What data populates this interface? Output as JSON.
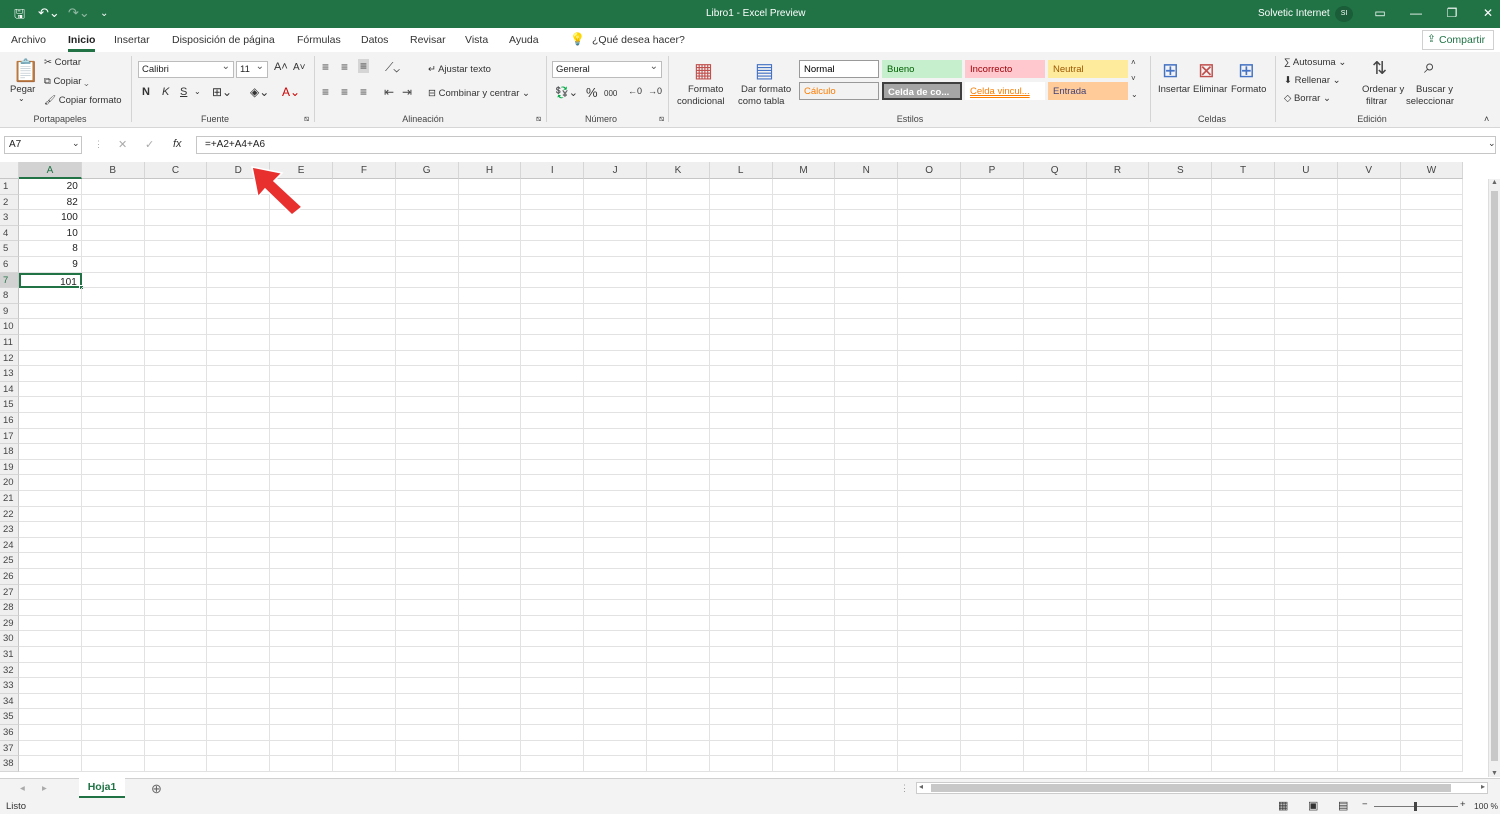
{
  "window": {
    "title": "Libro1 - Excel Preview",
    "user": "Solvetic Internet",
    "user_initials": "SI"
  },
  "tabs": [
    "Archivo",
    "Inicio",
    "Insertar",
    "Disposición de página",
    "Fórmulas",
    "Datos",
    "Revisar",
    "Vista",
    "Ayuda"
  ],
  "search_hint": "¿Qué desea hacer?",
  "share_label": "Compartir",
  "clipboard": {
    "paste": "Pegar",
    "cut": "Cortar",
    "copy": "Copiar",
    "format_painter": "Copiar formato",
    "group": "Portapapeles"
  },
  "font": {
    "name": "Calibri",
    "size": "11",
    "bold": "N",
    "italic": "K",
    "underline": "S",
    "group": "Fuente"
  },
  "alignment": {
    "wrap": "Ajustar texto",
    "merge": "Combinar y centrar",
    "group": "Alineación"
  },
  "number": {
    "format": "General",
    "percent": "%",
    "thousands": "000",
    "group": "Número"
  },
  "styles": {
    "cond_format": "Formato",
    "cond_format2": "condicional",
    "as_table": "Dar formato",
    "as_table2": "como tabla",
    "group": "Estilos",
    "items": [
      {
        "label": "Normal",
        "bg": "#ffffff",
        "fg": "#000000"
      },
      {
        "label": "Bueno",
        "bg": "#c6efce",
        "fg": "#006100"
      },
      {
        "label": "Incorrecto",
        "bg": "#ffc7ce",
        "fg": "#9c0006"
      },
      {
        "label": "Neutral",
        "bg": "#ffeb9c",
        "fg": "#9c5700"
      },
      {
        "label": "Cálculo",
        "bg": "#f2f2f2",
        "fg": "#fa7d00"
      },
      {
        "label": "Celda de co...",
        "bg": "#a5a5a5",
        "fg": "#ffffff"
      },
      {
        "label": "Celda vincul...",
        "bg": "#ffffff",
        "fg": "#fa7d00"
      },
      {
        "label": "Entrada",
        "bg": "#ffcc99",
        "fg": "#3f3f76"
      }
    ]
  },
  "cells_group": {
    "insert": "Insertar",
    "delete": "Eliminar",
    "format": "Formato",
    "group": "Celdas"
  },
  "editing": {
    "autosum": "Autosuma",
    "fill": "Rellenar",
    "clear": "Borrar",
    "sort": "Ordenar y",
    "sort2": "filtrar",
    "find": "Buscar y",
    "find2": "seleccionar",
    "group": "Edición"
  },
  "formula_bar": {
    "name_box": "A7",
    "formula": "=+A2+A4+A6",
    "fx": "fx"
  },
  "columns": [
    "A",
    "B",
    "C",
    "D",
    "E",
    "F",
    "G",
    "H",
    "I",
    "J",
    "K",
    "L",
    "M",
    "N",
    "O",
    "P",
    "Q",
    "R",
    "S",
    "T",
    "U",
    "V",
    "W"
  ],
  "row_count": 38,
  "column_a_values": [
    "20",
    "82",
    "100",
    "10",
    "8",
    "9",
    "101"
  ],
  "sheet_tab": "Hoja1",
  "status": {
    "ready": "Listo",
    "zoom": "100 %"
  },
  "accent": "#217346",
  "annotation_color": "#e8302f"
}
